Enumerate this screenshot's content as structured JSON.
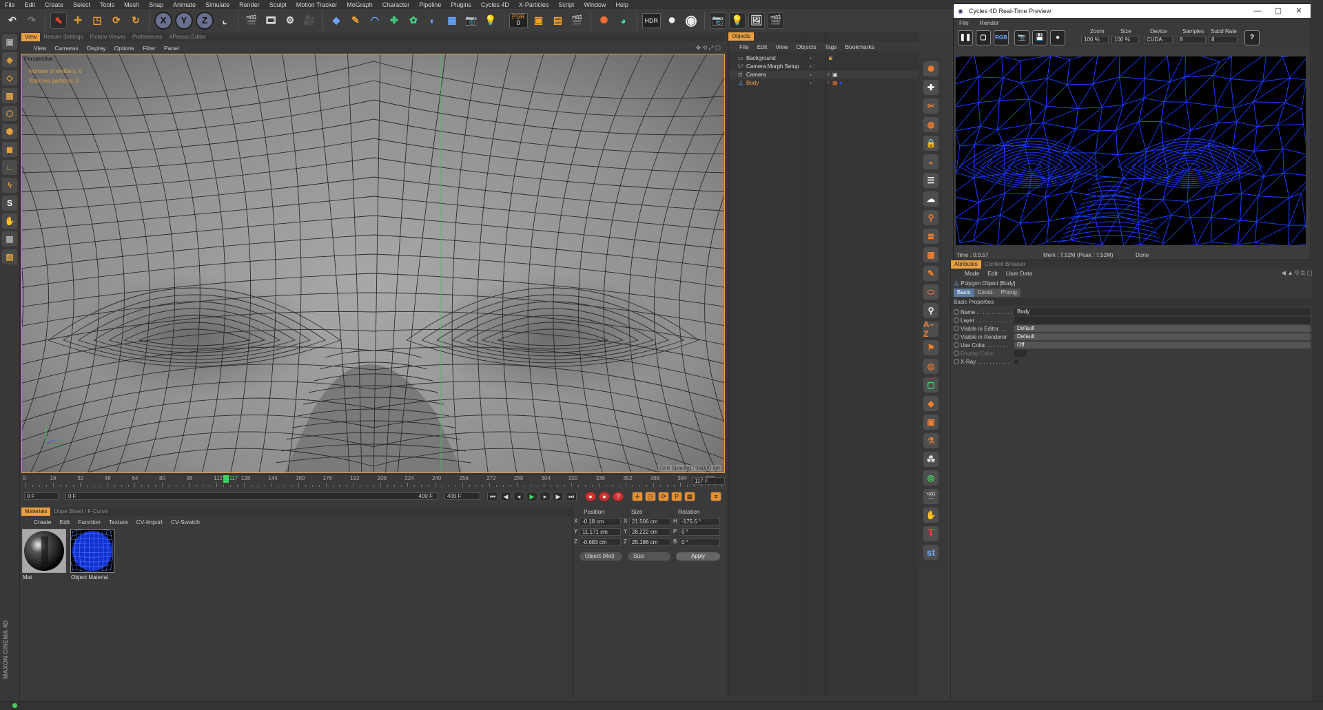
{
  "menubar": [
    "File",
    "Edit",
    "Create",
    "Select",
    "Tools",
    "Mesh",
    "Snap",
    "Animate",
    "Simulate",
    "Render",
    "Sculpt",
    "Motion Tracker",
    "MoGraph",
    "Character",
    "Pipeline",
    "Plugins",
    "Cycles 4D",
    "X-Particles",
    "Script",
    "Window",
    "Help"
  ],
  "toolbar": {
    "x": "X",
    "y": "Y",
    "z": "Z",
    "psr_label": "PSR",
    "psr_value": "0",
    "hdr": "HDR"
  },
  "viewport_tabs": [
    "View",
    "Render Settings",
    "Picture Viewer",
    "Preferences",
    "XPresso Editor"
  ],
  "viewport_menu": [
    "View",
    "Cameras",
    "Display",
    "Options",
    "Filter",
    "Panel"
  ],
  "viewport": {
    "label": "Perspective",
    "hud_emitters": "Number of emitters: 0",
    "hud_particles": "Total live particles: 0",
    "grid_spacing": "Grid Spacing : 10000 cm"
  },
  "timeline": {
    "ticks": [
      "0",
      "16",
      "32",
      "48",
      "64",
      "80",
      "96",
      "112",
      "128",
      "144",
      "160",
      "176",
      "192",
      "208",
      "224",
      "240",
      "256",
      "272",
      "288",
      "304",
      "320",
      "336",
      "352",
      "368",
      "384",
      "400"
    ],
    "current_frame": "117",
    "end_frame_field": "117 F",
    "start_field": "0 F",
    "range_start": "0 F",
    "range_end": "400 F",
    "max_field": "400 F"
  },
  "materials": {
    "tabs": [
      "Materials",
      "Dope Sheet / F-Curve"
    ],
    "menu": [
      "Create",
      "Edit",
      "Function",
      "Texture",
      "CV-Import",
      "CV-Swatch"
    ],
    "items": [
      {
        "name": "Mat"
      },
      {
        "name": "Object Material"
      }
    ]
  },
  "coordinates": {
    "headers": {
      "position": "Position",
      "size": "Size",
      "rotation": "Rotation"
    },
    "rows": [
      {
        "axis": "X",
        "pos": "-0.18 cm",
        "size_axis": "X",
        "size": "21.506 cm",
        "rot_axis": "H",
        "rot": "-175.5 °"
      },
      {
        "axis": "Y",
        "pos": "11.171 cm",
        "size_axis": "Y",
        "size": "28.222 cm",
        "rot_axis": "P",
        "rot": "0 °"
      },
      {
        "axis": "Z",
        "pos": "-0.683 cm",
        "size_axis": "Z",
        "size": "25.186 cm",
        "rot_axis": "B",
        "rot": "0 °"
      }
    ],
    "mode_dropdown": "Object (Rel)",
    "size_dropdown": "Size",
    "apply": "Apply"
  },
  "objects": {
    "title": "Objects",
    "menu": [
      "File",
      "Edit",
      "View",
      "Objects",
      "Tags",
      "Bookmarks"
    ],
    "items": [
      {
        "name": "Background",
        "selected": false
      },
      {
        "name": "Camera Morph Setup",
        "selected": false
      },
      {
        "name": "Camera",
        "selected": false
      },
      {
        "name": "Body",
        "selected": true
      }
    ]
  },
  "cycles": {
    "title": "Cycles 4D Real-Time Preview",
    "menu": [
      "File",
      "Render"
    ],
    "rgb": "RGB",
    "zoom_label": "Zoom",
    "zoom_value": "100 %",
    "size_label": "Size",
    "size_value": "100 %",
    "device_label": "Device",
    "device_value": "CUDA",
    "samples_label": "Samples",
    "samples_value": "8",
    "subd_label": "Subd Rate",
    "subd_value": "8",
    "status_time": "Time : 0:0.57",
    "status_mem": "Mem : 7.52M (Peak : 7.52M)",
    "status_done": "Done",
    "wire_color": "#1a3cff"
  },
  "attributes": {
    "tabs": [
      "Attributes",
      "Content Browser"
    ],
    "menu": [
      "Mode",
      "Edit",
      "User Data"
    ],
    "object_title": "Polygon Object [Body]",
    "subtabs": [
      "Basic",
      "Coord.",
      "Phong"
    ],
    "section": "Basic Properties",
    "fields": [
      {
        "label": "Name . . . . . . . . . . . .",
        "value": "Body",
        "style": "dark"
      },
      {
        "label": "Layer . . . . . . . . . . . .",
        "value": "",
        "style": "dark"
      },
      {
        "label": "Visible in Editor. . .",
        "value": "Default",
        "style": "drop"
      },
      {
        "label": "Visible in Renderer",
        "value": "Default",
        "style": "drop"
      },
      {
        "label": "Use Color. . . . . . . .",
        "value": "Off",
        "style": "drop"
      },
      {
        "label": "Display Color. . . . .",
        "value": "",
        "style": "none"
      },
      {
        "label": "X-Ray . . . . . . . . . . .",
        "value": "",
        "style": "none"
      }
    ]
  },
  "brand": "MAXON CINEMA 4D",
  "colors": {
    "accent": "#e8a040",
    "viewport_bg": "#8a8a8a",
    "active_green": "#40d060"
  }
}
